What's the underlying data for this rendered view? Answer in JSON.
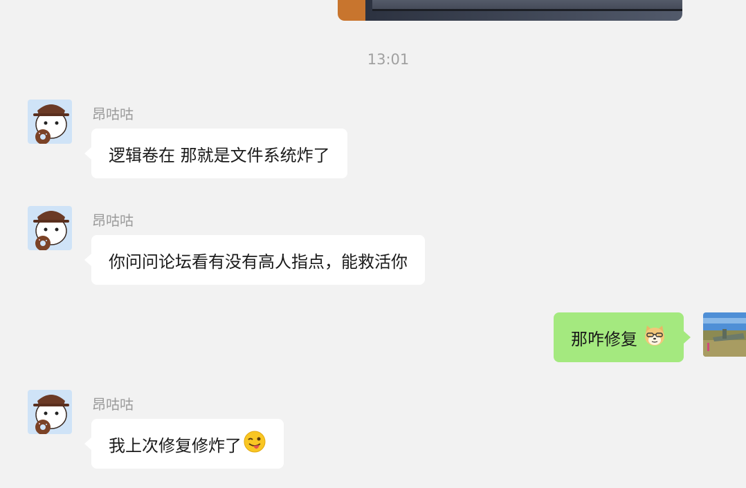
{
  "chat": {
    "timestamp": "13:01",
    "messages": [
      {
        "side": "left",
        "sender": "昂咕咕",
        "text": "逻辑卷在 那就是文件系统炸了"
      },
      {
        "side": "left",
        "sender": "昂咕咕",
        "text": "你问问论坛看有没有高人指点，能救活你"
      },
      {
        "side": "right",
        "text": "那咋修复",
        "emoji": "doge-emoji"
      },
      {
        "side": "left",
        "sender": "昂咕咕",
        "text": "我上次修复修炸了",
        "emoji": "winking-tongue-emoji"
      }
    ]
  },
  "colors": {
    "background": "#f2f2f2",
    "incoming_bubble": "#ffffff",
    "outgoing_bubble": "#a4e97f",
    "sender_name": "#9a9a9a",
    "timestamp": "#a0a0a0"
  },
  "icons": {
    "contact_avatar": "cartoon-puppy-with-hat-and-donut",
    "my_avatar": "airplane-on-grass-photo"
  }
}
